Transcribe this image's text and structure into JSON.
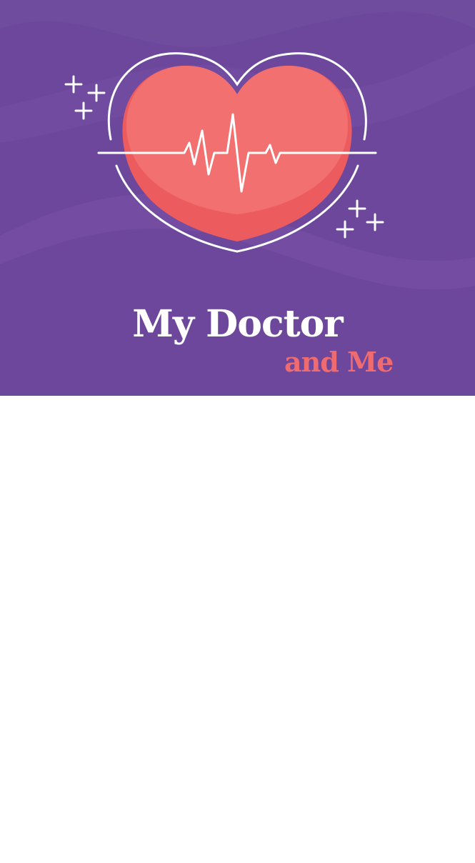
{
  "splash": {
    "title": "My Doctor",
    "subtitle": "and Me"
  },
  "icons": {
    "hero": "heart-with-heartbeat-icon",
    "sparkle": "plus-sparkle-icon"
  },
  "colors": {
    "background": "#6c479b",
    "wave": "#7a52a6",
    "heart": "#f27070",
    "heart_shadow": "#ec5c5f",
    "title": "#ffffff",
    "subtitle": "#f06b70",
    "screen": "#ffffff"
  }
}
